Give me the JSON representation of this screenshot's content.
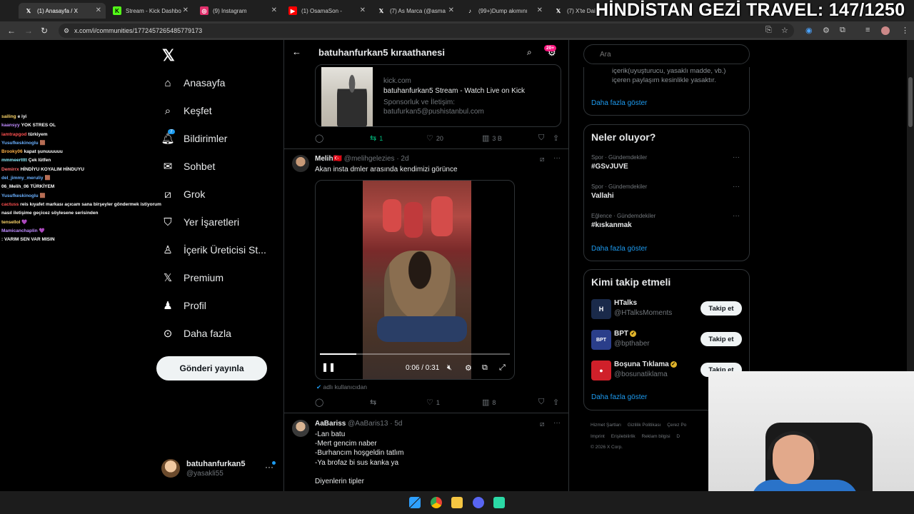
{
  "browser": {
    "tabs": [
      {
        "title": "(1) Anasayfa / X",
        "icon": "x-icon",
        "color": "#ffffff"
      },
      {
        "title": "Stream - Kick Dashbo",
        "icon": "kick-icon",
        "color": "#53fc18"
      },
      {
        "title": "(9) Instagram",
        "icon": "instagram-icon",
        "color": "#e1306c"
      },
      {
        "title": "(1) OsamaSon - ",
        "icon": "youtube-icon",
        "color": "#ff0000"
      },
      {
        "title": "(7) As Marca (@asma",
        "icon": "x-icon",
        "color": "#ffffff"
      },
      {
        "title": "(99+)Dump akımını",
        "icon": "tiktok-icon",
        "color": "#ffffff"
      },
      {
        "title": "(7) X'te Daily ",
        "icon": "x-icon",
        "color": "#ffffff"
      }
    ],
    "url": "x.com/i/communities/1772457265485779173"
  },
  "overlay": {
    "title": "HİNDİSTAN GEZİ TRAVEL: 147/1250"
  },
  "chat": [
    {
      "user": "sailing",
      "msg": "e iyi",
      "color": "#ffd86b"
    },
    {
      "user": "kaansyy",
      "msg": "YOK STRES OL",
      "color": "#c08cff"
    },
    {
      "user": "iamtrapgod",
      "msg": "türkiyem",
      "color": "#ff5050"
    },
    {
      "user": "Yusufkeskinoglu",
      "msg": "🟫",
      "color": "#6ab0ff"
    },
    {
      "user": "Brooky06",
      "msg": "kapat şunuuuuuu",
      "color": "#ffb347"
    },
    {
      "user": "mmmeertttt",
      "msg": "Çek lütfen",
      "color": "#8cf0ff"
    },
    {
      "user": "Demirrx",
      "msg": "HİNDİYU KOYALIM HİNDUYU",
      "color": "#ff6b6b"
    },
    {
      "user": "del_jimmy_meruliy",
      "msg": "🟫",
      "color": "#6ab0ff"
    },
    {
      "user": "06_Melih_06",
      "msg": "TÜRKİYEM",
      "color": "#ffffff"
    },
    {
      "user": "Yusufkeskinoglu",
      "msg": "🟫",
      "color": "#6ab0ff"
    },
    {
      "user": "cactuss",
      "msg": "reis kıyafet markası açıcam sana birşeyler göndermek istiyorum",
      "color": "#ff5050"
    },
    {
      "user": "",
      "msg": "nasıl iletişime geçicez söylesene serisinden",
      "color": "#ffffff"
    },
    {
      "user": "tensellol",
      "msg": "💜",
      "color": "#ffd86b"
    },
    {
      "user": "Mamicanchaplin",
      "msg": "💜",
      "color": "#c08cff"
    },
    {
      "user": "",
      "msg": ": VARIM SEN VAR MISIN",
      "color": "#ffffff"
    }
  ],
  "sidebar": {
    "items": [
      {
        "label": "Anasayfa",
        "icon": "home-icon"
      },
      {
        "label": "Keşfet",
        "icon": "search-icon"
      },
      {
        "label": "Bildirimler",
        "icon": "bell-icon",
        "badge": "7"
      },
      {
        "label": "Sohbet",
        "icon": "mail-icon"
      },
      {
        "label": "Grok",
        "icon": "grok-icon"
      },
      {
        "label": "Yer İşaretleri",
        "icon": "bookmark-icon"
      },
      {
        "label": "İçerik Üreticisi St...",
        "icon": "creator-icon"
      },
      {
        "label": "Premium",
        "icon": "x-icon"
      },
      {
        "label": "Profil",
        "icon": "person-icon"
      },
      {
        "label": "Daha fazla",
        "icon": "more-icon"
      }
    ],
    "post_button": "Gönderi yayınla",
    "account": {
      "name": "batuhanfurkan5",
      "handle": "@yasakli55"
    }
  },
  "community": {
    "title": "batuhanfurkan5 kıraathanesi",
    "badge": "20+"
  },
  "linkcard": {
    "domain": "kick.com",
    "title": "batuhanfurkan5 Stream - Watch Live on Kick",
    "desc_1": "Sponsorluk ve İletişim:",
    "desc_2": "batufurkan5@pushistanbul.com"
  },
  "actions_1": {
    "retweets": "1",
    "likes": "20",
    "views": "3 B"
  },
  "tweet_1": {
    "name": "Melih🇹🇷",
    "handle": "@melihgelezies",
    "time": "· 2d",
    "text": "Akan insta dmler arasında kendimizi görünce",
    "video": {
      "time": "0:06 / 0:31",
      "progress": 0.19
    },
    "from_users": "adlı kullanıcıdan",
    "likes": "1",
    "views": "8"
  },
  "tweet_2": {
    "name": "AaBariss",
    "handle": "@AaBaris13",
    "time": "· 5d",
    "lines": [
      "-Lan batu",
      "-Mert gencim naber",
      "-Burhancım hoşgeldin tatlım",
      "-Ya brofaz bi sus kanka ya",
      "",
      "Diyenlerin tipler"
    ]
  },
  "right": {
    "search_placeholder": "Ara",
    "rules_text": "içerik(uyuşturucu, yasaklı madde, vb.) içeren paylaşım kesinlikle yasaktır.",
    "more_link": "Daha fazla göster",
    "trends_title": "Neler oluyor?",
    "trends": [
      {
        "cat": "Spor · Gündemdekiler",
        "name": "#GSvJUVE"
      },
      {
        "cat": "Spor · Gündemdekiler",
        "name": "Vallahi"
      },
      {
        "cat": "Eğlence · Gündemdekiler",
        "name": "#kıskanmak"
      }
    ],
    "wtf_title": "Kimi takip etmeli",
    "wtf": [
      {
        "name": "HTalks",
        "handle": "@HTalksMoments",
        "verified": false,
        "color": "#1a2a4a",
        "initials": "H"
      },
      {
        "name": "BPT",
        "handle": "@bpthaber",
        "verified": true,
        "color": "#2a3e8a",
        "initials": "BPT"
      },
      {
        "name": "Boşuna Tıklama",
        "handle": "@bosunatiklama",
        "verified": true,
        "color": "#d0202a",
        "initials": "●"
      }
    ],
    "follow_label": "Takip et",
    "footer": [
      "Hizmet Şartları",
      "Gizlilik Politikası",
      "Çerez Po",
      "Imprint",
      "Erişilebilirlik",
      "Reklam bilgisi",
      "D",
      "© 2026 X Corp."
    ]
  }
}
